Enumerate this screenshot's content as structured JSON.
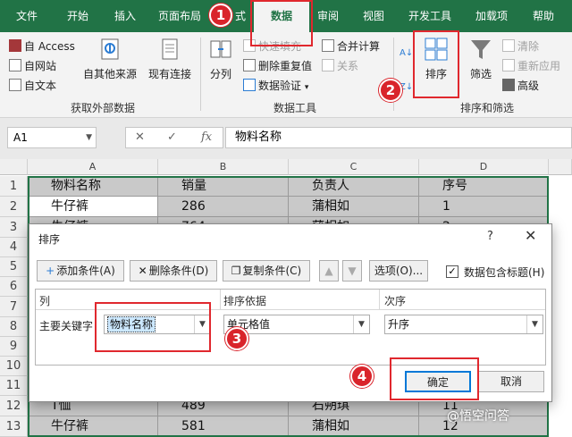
{
  "tabs": [
    {
      "label": "文件"
    },
    {
      "label": "开始"
    },
    {
      "label": "插入"
    },
    {
      "label": "页面布局"
    },
    {
      "label": "式"
    },
    {
      "label": "数据"
    },
    {
      "label": "审阅"
    },
    {
      "label": "视图"
    },
    {
      "label": "开发工具"
    },
    {
      "label": "加载项"
    },
    {
      "label": "帮助"
    }
  ],
  "ribbon": {
    "get_external": {
      "access": "自 Access",
      "web": "自网站",
      "text": "自文本",
      "other_sources": "自其他来源",
      "existing_conn": "现有连接",
      "group_label": "获取外部数据"
    },
    "data_tools": {
      "split": "分列",
      "flash_fill": "快速填充",
      "remove_dup": "删除重复值",
      "validation": "数据验证",
      "merge_calc": "合并计算",
      "relations": "关系",
      "group_label": "数据工具"
    },
    "sort_filter": {
      "sort": "排序",
      "filter": "筛选",
      "clear": "清除",
      "reapply": "重新应用",
      "advanced": "高级",
      "group_label": "排序和筛选"
    }
  },
  "formula_bar": {
    "name_box": "A1",
    "cancel": "✕",
    "confirm": "✓",
    "fx": "fx",
    "content": "物料名称"
  },
  "grid": {
    "columns": [
      "A",
      "B",
      "C",
      "D"
    ],
    "rows": [
      "1",
      "2",
      "3",
      "4",
      "5",
      "6",
      "7",
      "8",
      "9",
      "10",
      "11",
      "12",
      "13"
    ],
    "row1": [
      "物料名称",
      "销量",
      "负责人",
      "序号"
    ],
    "row2": [
      "牛仔裤",
      "286",
      "蒲相如",
      "1"
    ],
    "row3": [
      "牛仔裤",
      "764",
      "蒲相如",
      "2"
    ],
    "row12": [
      "T恤",
      "489",
      "石朔琪",
      "11"
    ],
    "row13": [
      "牛仔裤",
      "581",
      "蒲相如",
      "12"
    ]
  },
  "dialog": {
    "title": "排序",
    "help": "?",
    "close": "✕",
    "add_condition": "添加条件(A)",
    "delete_condition": "删除条件(D)",
    "copy_condition": "复制条件(C)",
    "move_up": "▲",
    "move_down": "▼",
    "options": "选项(O)...",
    "has_header_check": "✓",
    "has_header": "数据包含标题(H)",
    "col_header": "列",
    "sort_on_header": "排序依据",
    "order_header": "次序",
    "primary_key": "主要关键字",
    "column_value": "物料名称",
    "sort_on_value": "单元格值",
    "order_value": "升序",
    "ok": "确定",
    "cancel": "取消"
  },
  "badges": [
    "1",
    "2",
    "3",
    "4"
  ],
  "watermark": "@悟空问答",
  "colors": {
    "excel_green": "#217346",
    "annotation_red": "#e0282e",
    "badge_red": "#d9242b"
  }
}
